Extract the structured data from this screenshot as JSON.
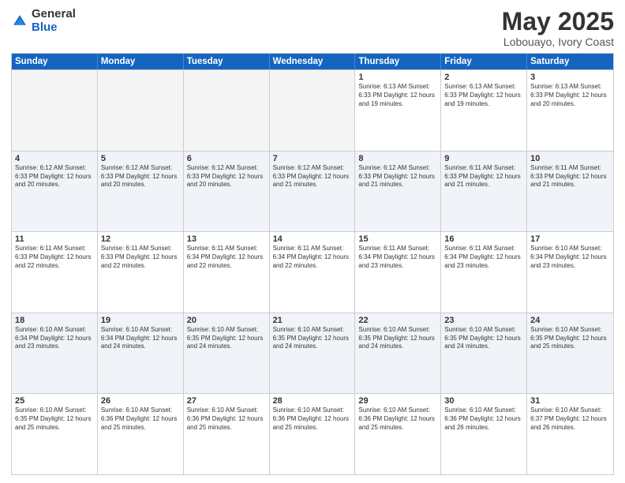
{
  "logo": {
    "general": "General",
    "blue": "Blue"
  },
  "header": {
    "title": "May 2025",
    "subtitle": "Lobouayo, Ivory Coast"
  },
  "weekdays": [
    "Sunday",
    "Monday",
    "Tuesday",
    "Wednesday",
    "Thursday",
    "Friday",
    "Saturday"
  ],
  "weeks": [
    [
      {
        "day": "",
        "info": ""
      },
      {
        "day": "",
        "info": ""
      },
      {
        "day": "",
        "info": ""
      },
      {
        "day": "",
        "info": ""
      },
      {
        "day": "1",
        "info": "Sunrise: 6:13 AM\nSunset: 6:33 PM\nDaylight: 12 hours\nand 19 minutes."
      },
      {
        "day": "2",
        "info": "Sunrise: 6:13 AM\nSunset: 6:33 PM\nDaylight: 12 hours\nand 19 minutes."
      },
      {
        "day": "3",
        "info": "Sunrise: 6:13 AM\nSunset: 6:33 PM\nDaylight: 12 hours\nand 20 minutes."
      }
    ],
    [
      {
        "day": "4",
        "info": "Sunrise: 6:12 AM\nSunset: 6:33 PM\nDaylight: 12 hours\nand 20 minutes."
      },
      {
        "day": "5",
        "info": "Sunrise: 6:12 AM\nSunset: 6:33 PM\nDaylight: 12 hours\nand 20 minutes."
      },
      {
        "day": "6",
        "info": "Sunrise: 6:12 AM\nSunset: 6:33 PM\nDaylight: 12 hours\nand 20 minutes."
      },
      {
        "day": "7",
        "info": "Sunrise: 6:12 AM\nSunset: 6:33 PM\nDaylight: 12 hours\nand 21 minutes."
      },
      {
        "day": "8",
        "info": "Sunrise: 6:12 AM\nSunset: 6:33 PM\nDaylight: 12 hours\nand 21 minutes."
      },
      {
        "day": "9",
        "info": "Sunrise: 6:11 AM\nSunset: 6:33 PM\nDaylight: 12 hours\nand 21 minutes."
      },
      {
        "day": "10",
        "info": "Sunrise: 6:11 AM\nSunset: 6:33 PM\nDaylight: 12 hours\nand 21 minutes."
      }
    ],
    [
      {
        "day": "11",
        "info": "Sunrise: 6:11 AM\nSunset: 6:33 PM\nDaylight: 12 hours\nand 22 minutes."
      },
      {
        "day": "12",
        "info": "Sunrise: 6:11 AM\nSunset: 6:33 PM\nDaylight: 12 hours\nand 22 minutes."
      },
      {
        "day": "13",
        "info": "Sunrise: 6:11 AM\nSunset: 6:34 PM\nDaylight: 12 hours\nand 22 minutes."
      },
      {
        "day": "14",
        "info": "Sunrise: 6:11 AM\nSunset: 6:34 PM\nDaylight: 12 hours\nand 22 minutes."
      },
      {
        "day": "15",
        "info": "Sunrise: 6:11 AM\nSunset: 6:34 PM\nDaylight: 12 hours\nand 23 minutes."
      },
      {
        "day": "16",
        "info": "Sunrise: 6:11 AM\nSunset: 6:34 PM\nDaylight: 12 hours\nand 23 minutes."
      },
      {
        "day": "17",
        "info": "Sunrise: 6:10 AM\nSunset: 6:34 PM\nDaylight: 12 hours\nand 23 minutes."
      }
    ],
    [
      {
        "day": "18",
        "info": "Sunrise: 6:10 AM\nSunset: 6:34 PM\nDaylight: 12 hours\nand 23 minutes."
      },
      {
        "day": "19",
        "info": "Sunrise: 6:10 AM\nSunset: 6:34 PM\nDaylight: 12 hours\nand 24 minutes."
      },
      {
        "day": "20",
        "info": "Sunrise: 6:10 AM\nSunset: 6:35 PM\nDaylight: 12 hours\nand 24 minutes."
      },
      {
        "day": "21",
        "info": "Sunrise: 6:10 AM\nSunset: 6:35 PM\nDaylight: 12 hours\nand 24 minutes."
      },
      {
        "day": "22",
        "info": "Sunrise: 6:10 AM\nSunset: 6:35 PM\nDaylight: 12 hours\nand 24 minutes."
      },
      {
        "day": "23",
        "info": "Sunrise: 6:10 AM\nSunset: 6:35 PM\nDaylight: 12 hours\nand 24 minutes."
      },
      {
        "day": "24",
        "info": "Sunrise: 6:10 AM\nSunset: 6:35 PM\nDaylight: 12 hours\nand 25 minutes."
      }
    ],
    [
      {
        "day": "25",
        "info": "Sunrise: 6:10 AM\nSunset: 6:35 PM\nDaylight: 12 hours\nand 25 minutes."
      },
      {
        "day": "26",
        "info": "Sunrise: 6:10 AM\nSunset: 6:36 PM\nDaylight: 12 hours\nand 25 minutes."
      },
      {
        "day": "27",
        "info": "Sunrise: 6:10 AM\nSunset: 6:36 PM\nDaylight: 12 hours\nand 25 minutes."
      },
      {
        "day": "28",
        "info": "Sunrise: 6:10 AM\nSunset: 6:36 PM\nDaylight: 12 hours\nand 25 minutes."
      },
      {
        "day": "29",
        "info": "Sunrise: 6:10 AM\nSunset: 6:36 PM\nDaylight: 12 hours\nand 25 minutes."
      },
      {
        "day": "30",
        "info": "Sunrise: 6:10 AM\nSunset: 6:36 PM\nDaylight: 12 hours\nand 26 minutes."
      },
      {
        "day": "31",
        "info": "Sunrise: 6:10 AM\nSunset: 6:37 PM\nDaylight: 12 hours\nand 26 minutes."
      }
    ]
  ]
}
